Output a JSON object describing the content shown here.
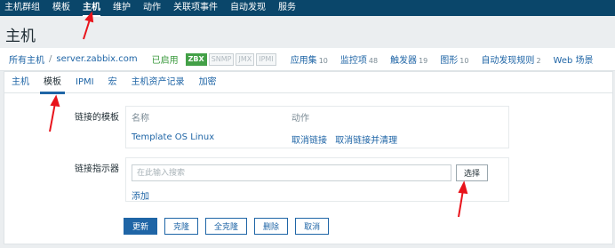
{
  "topnav": {
    "items": [
      "主机群组",
      "模板",
      "主机",
      "维护",
      "动作",
      "关联项事件",
      "自动发现",
      "服务"
    ],
    "active": 2
  },
  "page_title": "主机",
  "hostbar": {
    "all_hosts": "所有主机",
    "separator": "/",
    "host_name": "server.zabbix.com",
    "status": "已启用",
    "badges": [
      {
        "label": "ZBX",
        "on": true
      },
      {
        "label": "SNMP",
        "on": false
      },
      {
        "label": "JMX",
        "on": false
      },
      {
        "label": "IPMI",
        "on": false
      }
    ],
    "links": [
      {
        "label": "应用集",
        "count": "10"
      },
      {
        "label": "监控项",
        "count": "48"
      },
      {
        "label": "触发器",
        "count": "19"
      },
      {
        "label": "图形",
        "count": "10"
      },
      {
        "label": "自动发现规则",
        "count": "2"
      },
      {
        "label": "Web 场景",
        "count": ""
      }
    ]
  },
  "tabs": [
    "主机",
    "模板",
    "IPMI",
    "宏",
    "主机资产记录",
    "加密"
  ],
  "active_tab": 1,
  "form": {
    "linked_templates_label": "链接的模板",
    "table_headers": [
      "名称",
      "动作"
    ],
    "template_name": "Template OS Linux",
    "unlink": "取消链接",
    "unlink_clear": "取消链接并清理",
    "link_indicator_label": "链接指示器",
    "search_placeholder": "在此输入搜索",
    "select_button": "选择",
    "add_link": "添加"
  },
  "buttons": [
    "更新",
    "克隆",
    "全克隆",
    "删除",
    "取消"
  ],
  "colors": {
    "nav_bg": "#0a466a",
    "link": "#1f65a6",
    "enabled": "#3a9a3d",
    "zbx_badge": "#43a047",
    "annotation": "#e8131b"
  }
}
